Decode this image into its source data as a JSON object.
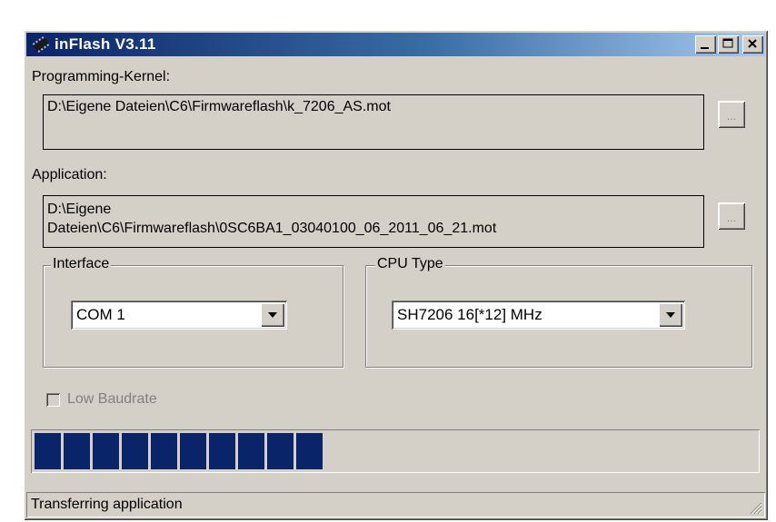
{
  "window": {
    "title": "inFlash V3.11",
    "icon": "chip-icon",
    "controls": [
      "minimize-icon",
      "maximize-icon",
      "close-icon"
    ]
  },
  "kernel": {
    "label": "Programming-Kernel:",
    "path": "D:\\Eigene Dateien\\C6\\Firmwareflash\\k_7206_AS.mot",
    "browse_label": "..."
  },
  "application": {
    "label": "Application:",
    "path_line1": "D:\\Eigene",
    "path_line2": "Dateien\\C6\\Firmwareflash\\0SC6BA1_03040100_06_2011_06_21.mot",
    "browse_label": "..."
  },
  "interface": {
    "group_label": "Interface",
    "selected": "COM 1"
  },
  "cpu": {
    "group_label": "CPU Type",
    "selected": "SH7206 16[*12] MHz"
  },
  "low_baudrate": {
    "label": "Low Baudrate",
    "checked": false,
    "enabled": false
  },
  "progress": {
    "fraction": 0.4,
    "color": "#0a246a"
  },
  "status": {
    "text": "Transferring application"
  }
}
